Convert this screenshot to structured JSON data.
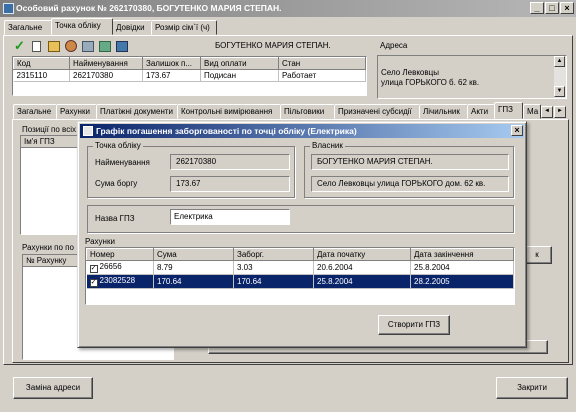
{
  "window": {
    "title": "Особовий рахунок № 262170380, БОГУТЕНКО МАРИЯ СТЕПАН."
  },
  "main_tabs": [
    {
      "label": "Загальне"
    },
    {
      "label": "Точка обліку"
    },
    {
      "label": "Довідки"
    },
    {
      "label": "Розмір сім`ї (ч)"
    }
  ],
  "owner_name": "БОГУТЕНКО МАРИЯ СТЕПАН.",
  "upper_table": {
    "columns": [
      "Код",
      "Найменування",
      "Залишок п...",
      "Вид оплати",
      "Стан"
    ],
    "rows": [
      [
        "2315110",
        "262170380",
        "173.67",
        "Подисан",
        "Работает"
      ]
    ]
  },
  "address": {
    "label": "Адреса",
    "line1": "Село Левковцы",
    "line2": "улица ГОРЬКОГО б. 62 кв."
  },
  "inner_tabs": [
    {
      "label": "Загальне"
    },
    {
      "label": "Рахунки"
    },
    {
      "label": "Платіжні документи"
    },
    {
      "label": "Контрольні вимірювання"
    },
    {
      "label": "Пільговики"
    },
    {
      "label": "Призначені субсидії"
    },
    {
      "label": "Лічильник"
    },
    {
      "label": "Акти"
    },
    {
      "label": "ГПЗ"
    },
    {
      "label": "Ма"
    }
  ],
  "bg_panel": {
    "positions_label": "Позиції по всіх",
    "gpz_col": "Ім'я ГПЗ",
    "accounts_label": "Рахунки по по",
    "account_col": "№ Рахунку",
    "right_btn_suffix": "к"
  },
  "dialog": {
    "title": "Графік погашення заборгованості по точці обліку (Електрика)",
    "account_group": "Точка обліку",
    "name_label": "Найменування",
    "name_value": "262170380",
    "debt_label": "Сума боргу",
    "debt_value": "173.67",
    "owner_group": "Власник",
    "owner_value": "БОГУТЕНКО МАРИЯ СТЕПАН.",
    "owner_address": "Село Левковцы улица ГОРЬКОГО дом. 62 кв.",
    "gpz_name_label": "Назва ГПЗ",
    "gpz_name_value": "Електрика",
    "accounts_label": "Рахунки",
    "columns": [
      "Номер",
      "Сума",
      "Заборг.",
      "Дата початку",
      "Дата закінчення"
    ],
    "rows": [
      {
        "checked": "✓",
        "number": "26656",
        "sum": "8.79",
        "debt": "3.03",
        "start": "20.6.2004",
        "end": "25.8.2004"
      },
      {
        "checked": "✓",
        "number": "23082528",
        "sum": "170.64",
        "debt": "170.64",
        "start": "25.8.2004",
        "end": "28.2.2005"
      }
    ],
    "create_button": "Створити ГПЗ"
  },
  "footer": {
    "change_address": "Заміна адреси",
    "close": "Закрити"
  },
  "colors": {
    "selection": "#0a246a",
    "dialog_title": "#0a246a",
    "window_face": "#d4d0c8"
  }
}
